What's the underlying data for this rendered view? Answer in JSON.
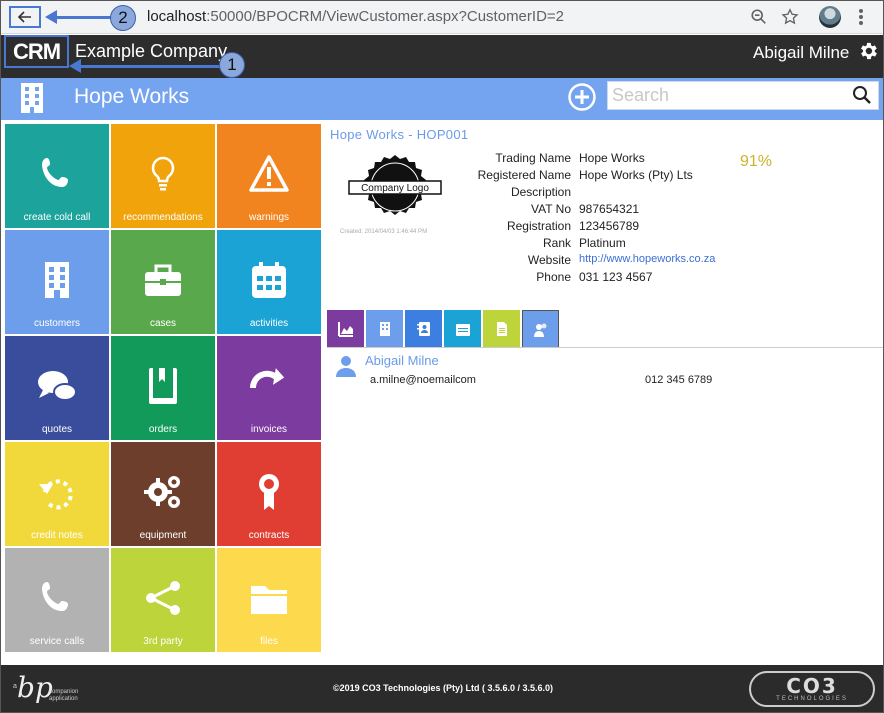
{
  "browser": {
    "url_host": "localhost",
    "url_path": ":50000/BPOCRM/ViewCustomer.aspx?CustomerID=2"
  },
  "callouts": {
    "first": "1",
    "second": "2"
  },
  "header": {
    "logo_text": "CRM",
    "company": "Example Company",
    "user": "Abigail Milne"
  },
  "customer_bar": {
    "name": "Hope Works",
    "search_placeholder": "Search"
  },
  "tiles": [
    {
      "label": "create cold call",
      "color": "#1ba39c",
      "icon": "phone-icon"
    },
    {
      "label": "recommendations",
      "color": "#f0a30a",
      "icon": "lightbulb-icon"
    },
    {
      "label": "warnings",
      "color": "#f1841f",
      "icon": "warning-icon"
    },
    {
      "label": "customers",
      "color": "#6d9eeb",
      "icon": "building-icon"
    },
    {
      "label": "cases",
      "color": "#5aa84c",
      "icon": "briefcase-icon"
    },
    {
      "label": "activities",
      "color": "#1aa3d4",
      "icon": "calendar-icon"
    },
    {
      "label": "quotes",
      "color": "#3a4d9c",
      "icon": "chat-bubbles-icon"
    },
    {
      "label": "orders",
      "color": "#129a5b",
      "icon": "book-icon"
    },
    {
      "label": "invoices",
      "color": "#7c3b9e",
      "icon": "redo-arrow-icon"
    },
    {
      "label": "credit notes",
      "color": "#f2d93b",
      "icon": "undo-arrow-icon"
    },
    {
      "label": "equipment",
      "color": "#6d3e2b",
      "icon": "gears-icon"
    },
    {
      "label": "contracts",
      "color": "#e03e32",
      "icon": "award-icon"
    },
    {
      "label": "service calls",
      "color": "#b2b2b2",
      "icon": "phone-icon"
    },
    {
      "label": "3rd party",
      "color": "#bdd43a",
      "icon": "share-icon"
    },
    {
      "label": "files",
      "color": "#fdd94e",
      "icon": "folder-icon"
    }
  ],
  "detail": {
    "title": "Hope Works - HOP001",
    "logo_text": "Company Logo",
    "created": "Created: 2014/04/03 1:46:44 PM",
    "percent": "91%",
    "fields": [
      {
        "label": "Trading Name",
        "value": "Hope Works"
      },
      {
        "label": "Registered Name",
        "value": "Hope Works (Pty) Lts"
      },
      {
        "label": "Description",
        "value": ""
      },
      {
        "label": "VAT No",
        "value": "987654321"
      },
      {
        "label": "Registration",
        "value": "123456789"
      },
      {
        "label": "Rank",
        "value": "Platinum"
      },
      {
        "label": "Website",
        "value": "http://www.hopeworks.co.za"
      },
      {
        "label": "Phone",
        "value": "031 123 4567"
      }
    ]
  },
  "tabs": [
    {
      "name": "tab-dashboard",
      "icon": "area-chart-icon",
      "color": "#7c3b9e"
    },
    {
      "name": "tab-customer",
      "icon": "building-icon",
      "color": "#6d9eeb"
    },
    {
      "name": "tab-addressbook",
      "icon": "address-book-icon",
      "color": "#3d7fe0"
    },
    {
      "name": "tab-activities",
      "icon": "calendar-icon",
      "color": "#1aa3d4"
    },
    {
      "name": "tab-documents",
      "icon": "document-icon",
      "color": "#bdd43a"
    },
    {
      "name": "tab-contacts",
      "icon": "contacts-icon",
      "color": "#6d9eeb"
    }
  ],
  "contact": {
    "name": "Abigail Milne",
    "email": "a.milne@noemailcom",
    "phone": "012 345 6789"
  },
  "footer": {
    "bp_mark": "bp",
    "bp_small_a": "a",
    "bp_text_line1": "companion",
    "bp_text_line2": "application",
    "copyright": "©2019 CO3 Technologies (Pty) Ltd ( 3.5.6.0 / 3.5.6.0)",
    "co3_logo": "CO3",
    "co3_sub": "TECHNOLOGIES"
  }
}
